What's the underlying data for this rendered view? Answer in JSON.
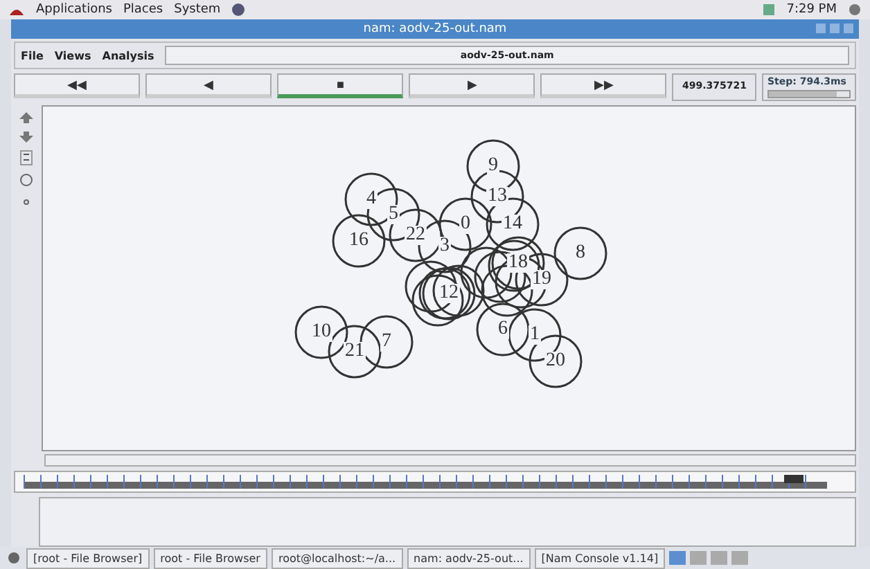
{
  "top_panel": {
    "menus": [
      "Applications",
      "Places",
      "System"
    ],
    "clock": "7:29 PM"
  },
  "window": {
    "title": "nam: aodv-25-out.nam"
  },
  "menu": [
    "File",
    "Views",
    "Analysis"
  ],
  "file_field": "aodv-25-out.nam",
  "controls": [
    {
      "label": "◀◀",
      "selected": false
    },
    {
      "label": "◀",
      "selected": false
    },
    {
      "label": "■",
      "selected": true
    },
    {
      "label": "▶",
      "selected": false
    },
    {
      "label": "▶▶",
      "selected": false
    }
  ],
  "time": "499.375721",
  "step": {
    "label": "Step: 794.3ms",
    "level": 0.85
  },
  "nodes": [
    {
      "label": "9"
    },
    {
      "label": "13"
    },
    {
      "label": "4"
    },
    {
      "label": "5"
    },
    {
      "label": "0"
    },
    {
      "label": "14"
    },
    {
      "label": "16"
    },
    {
      "label": "22"
    },
    {
      "label": "3"
    },
    {
      "label": "8"
    },
    {
      "label": "18"
    },
    {
      "label": "19"
    },
    {
      "label": "12"
    },
    {
      "label": "6"
    },
    {
      "label": "1"
    },
    {
      "label": "20"
    },
    {
      "label": "10"
    },
    {
      "label": "21"
    },
    {
      "label": "7"
    }
  ],
  "timeline": {
    "level": 0.97
  },
  "taskbar": [
    {
      "label": "[root - File Browser]"
    },
    {
      "label": "root - File Browser"
    },
    {
      "label": "root@localhost:~/a..."
    },
    {
      "label": "nam: aodv-25-out..."
    },
    {
      "label": "[Nam Console v1.14]"
    }
  ]
}
